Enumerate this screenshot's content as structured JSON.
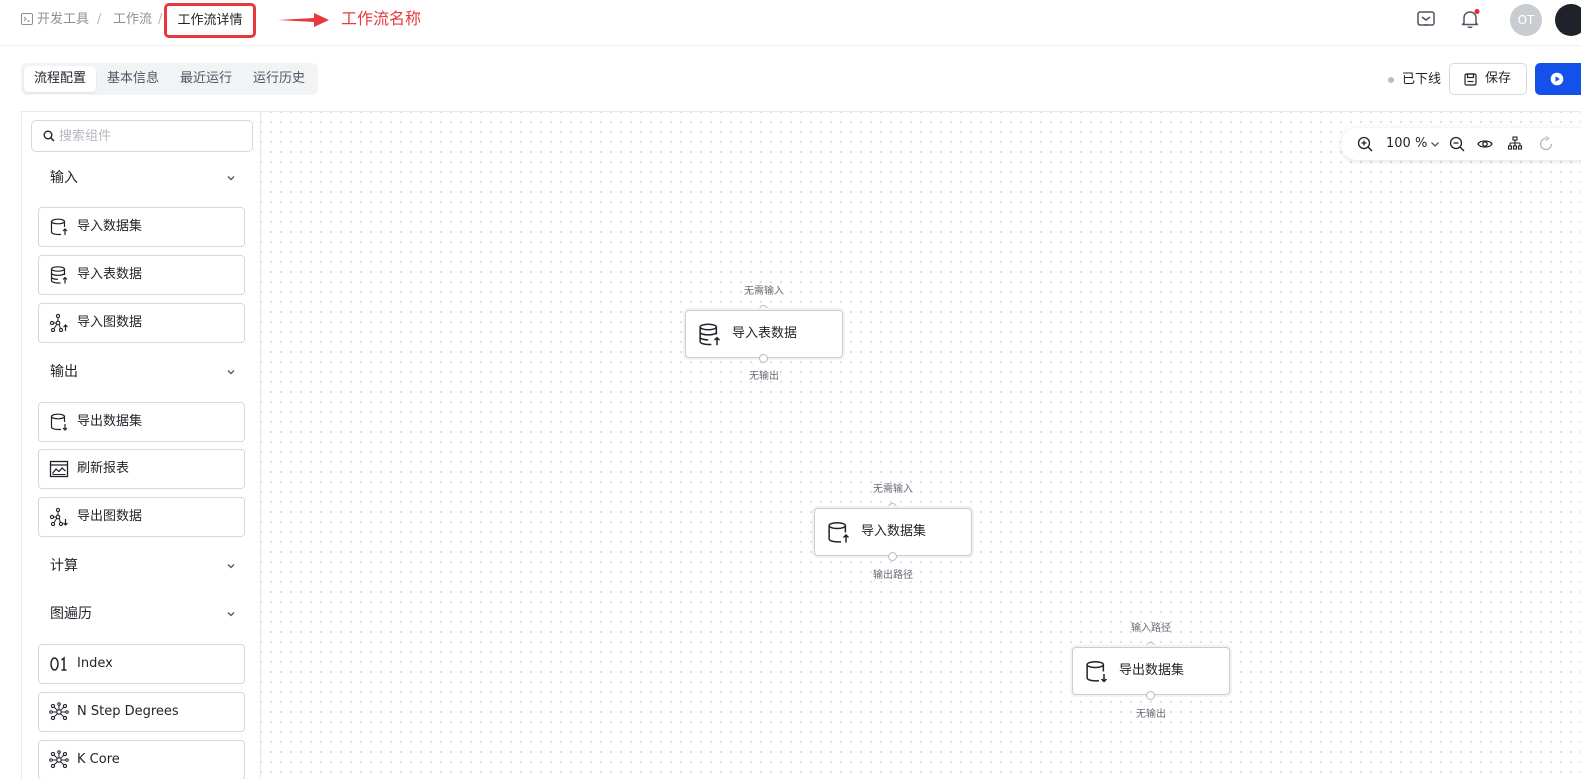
{
  "breadcrumb": {
    "items": [
      "开发工具",
      "工作流"
    ],
    "separator": "/",
    "current": "工作流详情"
  },
  "annotation": {
    "text": "工作流名称",
    "color": "#e8383d"
  },
  "topbar": {
    "avatar_initials": "OT",
    "notification_dot_color": "#f5222d"
  },
  "tabs": [
    "流程配置",
    "基本信息",
    "最近运行",
    "运行历史"
  ],
  "status": {
    "label": "已下线"
  },
  "toolbar": {
    "save_label": "保存",
    "primary_color": "#1451eb"
  },
  "sidebar": {
    "search_placeholder": "搜索组件",
    "groups": [
      {
        "title": "输入",
        "items": [
          "导入数据集",
          "导入表数据",
          "导入图数据"
        ]
      },
      {
        "title": "输出",
        "items": [
          "导出数据集",
          "刷新报表",
          "导出图数据"
        ]
      },
      {
        "title": "计算",
        "items": []
      },
      {
        "title": "图遍历",
        "items": [
          "Index",
          "N Step Degrees",
          "K Core"
        ]
      }
    ]
  },
  "zoom": {
    "level": "100 %"
  },
  "canvas": {
    "nodes": [
      {
        "label": "导入表数据",
        "input": "无需输入",
        "output": "无输出"
      },
      {
        "label": "导入数据集",
        "input": "无需输入",
        "output": "输出路径"
      },
      {
        "label": "导出数据集",
        "input": "输入路径",
        "output": "无输出"
      }
    ]
  }
}
